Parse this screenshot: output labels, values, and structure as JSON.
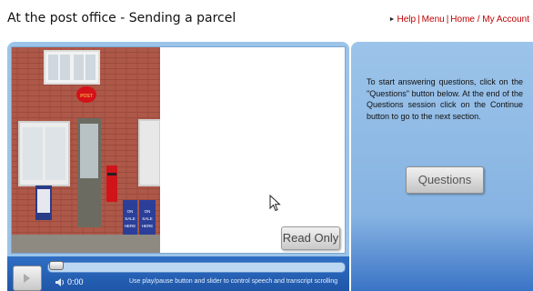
{
  "header": {
    "title": "At the post office - Sending a parcel",
    "links": {
      "help": "Help",
      "menu": "Menu",
      "home": "Home / My Account"
    }
  },
  "video": {
    "read_only_label": "Read Only",
    "time": "0:00",
    "help_text": "Use play/pause button and slider to control speech and transcript scrolling",
    "sign_text": "ON SALE HERE",
    "post_office_sign": "POST OFFICE"
  },
  "side_panel": {
    "instructions": "To start answering questions, click on the \"Questions\" button below. At the end of the Questions session click on the Continue button to go to the next section.",
    "questions_label": "Questions"
  },
  "colors": {
    "link_red": "#c00000",
    "panel_blue": "#9cc4e8",
    "control_blue": "#1f56a8"
  }
}
